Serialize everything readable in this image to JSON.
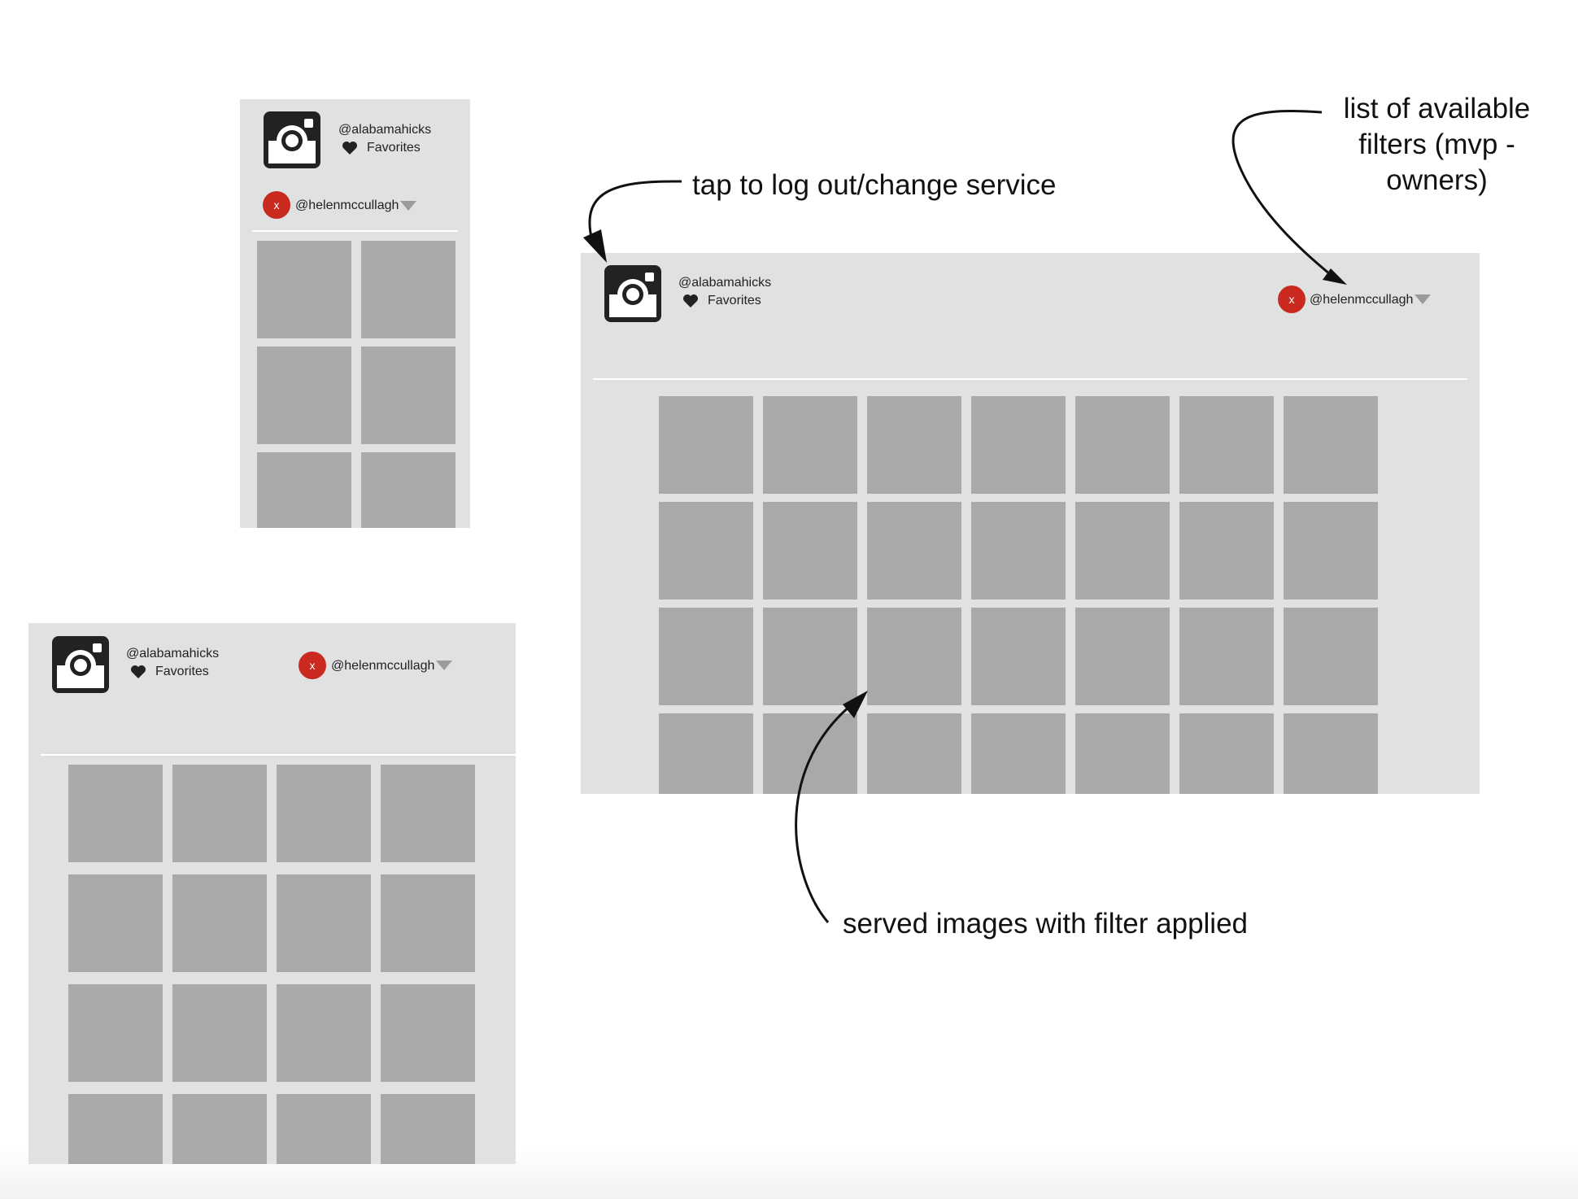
{
  "account": {
    "handle": "@alabamahicks",
    "favorites_label": "Favorites",
    "user_name": "@helenmccullagh",
    "avatar_letter": "x",
    "avatar_color": "#c9291f",
    "logo_icon": "instagram-icon",
    "favorites_icon": "heart-icon",
    "dropdown_icon": "caret-down-icon"
  },
  "mockups": [
    {
      "id": "phone",
      "columns": 2,
      "rows_shown": 3
    },
    {
      "id": "tablet",
      "columns": 4,
      "rows_shown": 4
    },
    {
      "id": "desktop",
      "columns": 7,
      "rows_shown": 4
    }
  ],
  "annotations": {
    "logout": "tap to log out/change service",
    "filters": [
      "list of available",
      "filters (mvp -",
      "owners)"
    ],
    "served": "served images with filter applied"
  },
  "colors": {
    "panel": "#dfe2e1",
    "tile": "#a8a9a8",
    "icon": "#222222"
  }
}
